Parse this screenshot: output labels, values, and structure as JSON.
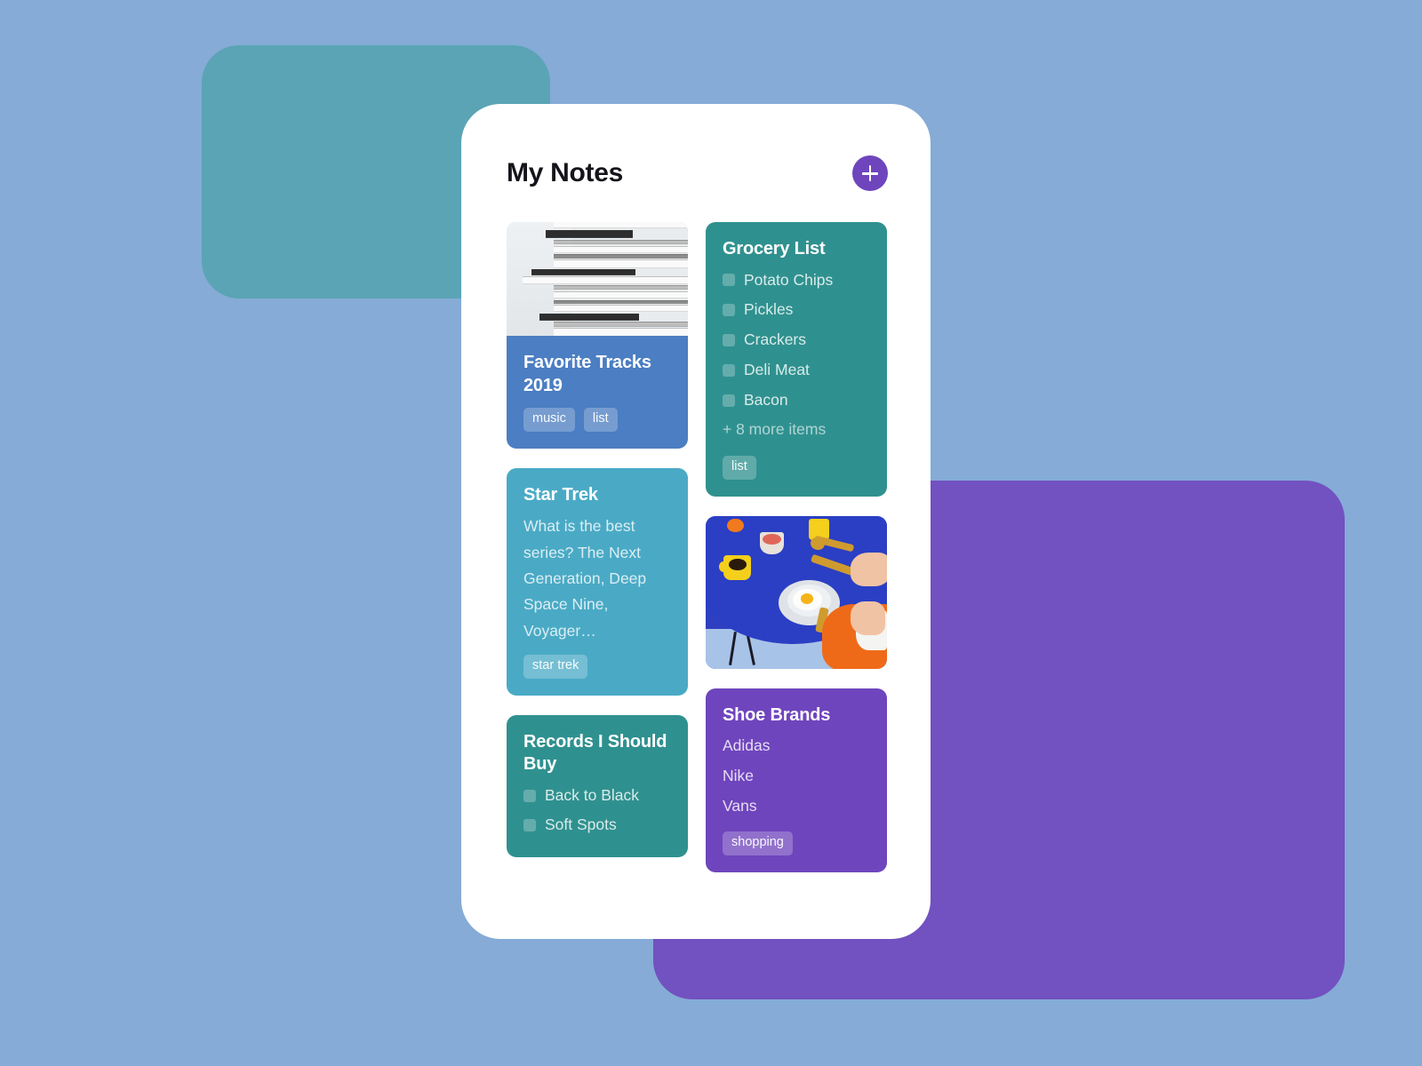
{
  "background": {
    "page_color": "#85abd6",
    "teal_shape_color": "#5aa4b5",
    "purple_shape_color": "#7251c0"
  },
  "app": {
    "title": "My Notes",
    "add_button_label": "+",
    "add_button_color": "#6f45bd",
    "surface_color": "#ffffff"
  },
  "notes": {
    "favorite_tracks": {
      "title": "Favorite Tracks 2019",
      "color": "#4b7ec2",
      "photo": "vinyl-records-stack-photo",
      "tags": [
        "music",
        "list"
      ]
    },
    "grocery_list": {
      "title": "Grocery List",
      "color": "#2f918f",
      "items": [
        "Potato Chips",
        "Pickles",
        "Crackers",
        "Deli Meat",
        "Bacon"
      ],
      "more_text": "+ 8 more items",
      "tags": [
        "list"
      ]
    },
    "star_trek": {
      "title": "Star Trek",
      "color": "#4aaac5",
      "body": "What is the best series? The Next Generation, Deep Space Nine, Voyager…",
      "tags": [
        "star trek"
      ]
    },
    "breakfast_photo": {
      "photo": "breakfast-egg-on-blue-table-photo"
    },
    "shoe_brands": {
      "title": "Shoe Brands",
      "color": "#6f45bd",
      "items": [
        "Adidas",
        "Nike",
        "Vans"
      ],
      "tags": [
        "shopping"
      ]
    },
    "records_to_buy": {
      "title": "Records I Should Buy",
      "color": "#2f918f",
      "items": [
        "Back to Black",
        "Soft Spots"
      ]
    }
  }
}
